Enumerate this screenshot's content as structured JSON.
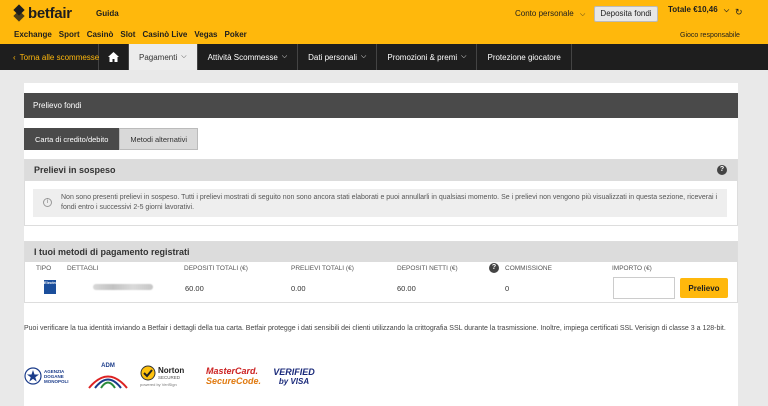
{
  "header": {
    "brand": "betfair",
    "guida": "Guida",
    "account_label": "Conto personale",
    "deposit_button": "Deposita fondi",
    "total": "Totale €10,46",
    "responsible": "Gioco responsabile",
    "main_nav": [
      "Exchange",
      "Sport",
      "Casinò",
      "Slot",
      "Casinò Live",
      "Vegas",
      "Poker"
    ]
  },
  "subnav": {
    "back": "Torna alle scommesse",
    "items": [
      "Pagamenti",
      "Attività Scommesse",
      "Dati personali",
      "Promozioni & premi",
      "Protezione giocatore"
    ]
  },
  "panel": {
    "title": "Prelievo fondi",
    "tabs": [
      "Carta di credito/debito",
      "Metodi alternativi"
    ],
    "pending": {
      "title": "Prelievi in sospeso",
      "info": "Non sono presenti prelievi in sospeso. Tutti i prelievi mostrati di seguito non sono ancora stati elaborati e puoi annullarli in qualsiasi momento. Se i prelievi non vengono più visualizzati in questa sezione, riceverai i fondi entro i successivi 2-5 giorni lavorativi."
    },
    "methods": {
      "title": "I tuoi metodi di pagamento registrati",
      "columns": [
        "TIPO",
        "DETTAGLI",
        "DEPOSITI TOTALI (€)",
        "PRELIEVI TOTALI (€)",
        "DEPOSITI NETTI (€)",
        "COMMISSIONE",
        "IMPORTO (€)"
      ],
      "row": {
        "card_label": "Electron",
        "deposits": "60.00",
        "withdrawals": "0.00",
        "net": "60.00",
        "commission": "0",
        "amount": ""
      },
      "button": "Prelievo"
    },
    "footnote": "Puoi verificare la tua identità inviando a Betfair i dettagli della tua carta. Betfair protegge i dati sensibili dei clienti utilizzando la crittografia SSL durante la trasmissione. Inoltre, impiega certificati SSL Verisign di classe 3 a 128-bit.",
    "logos": {
      "agenzia": [
        "AGENZIA",
        "DOGANE",
        "MONOPOLI"
      ],
      "adm": "ADM",
      "norton": [
        "Norton",
        "SECURED",
        "powered by VeriSign"
      ],
      "mastercard": [
        "MasterCard.",
        "SecureCode."
      ],
      "visa": [
        "VERIFIED",
        "by VISA"
      ]
    }
  },
  "colors": {
    "accent": "#ffb80c",
    "dark": "#1e1e1e",
    "panel_head": "#4a4a4a"
  }
}
